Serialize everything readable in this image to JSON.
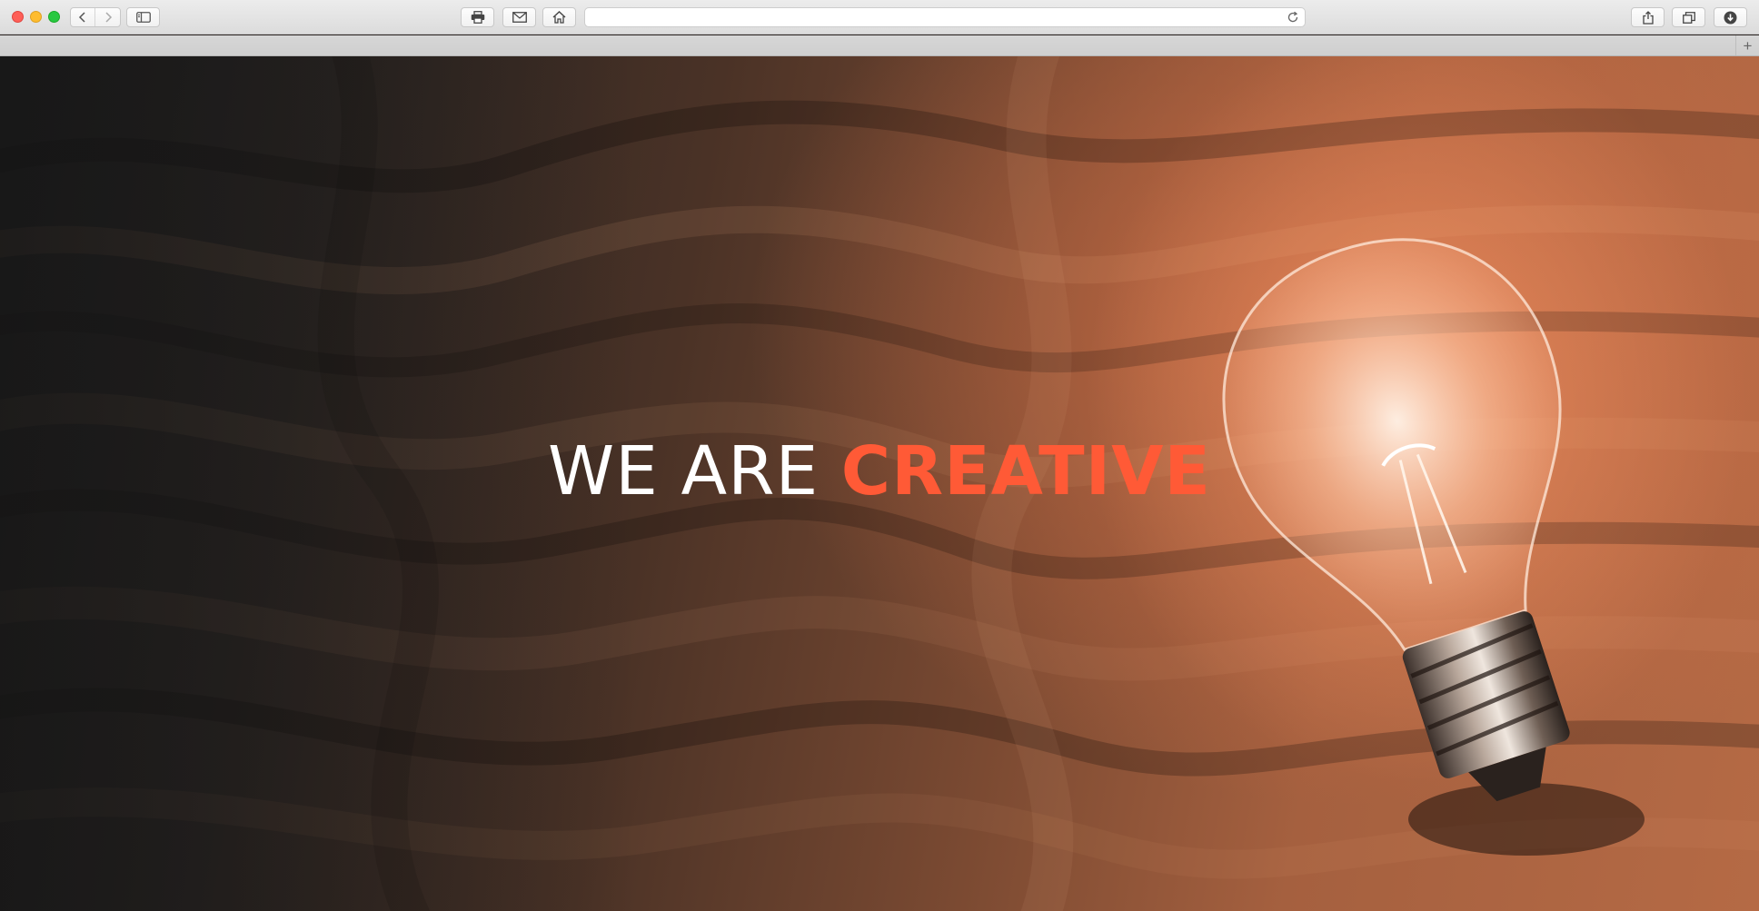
{
  "browser": {
    "address_value": "",
    "address_placeholder": "",
    "new_tab_glyph": "+"
  },
  "hero": {
    "headline_white": "WE ARE",
    "headline_accent": "CREATIVE",
    "accent_color": "#ff5a36"
  }
}
